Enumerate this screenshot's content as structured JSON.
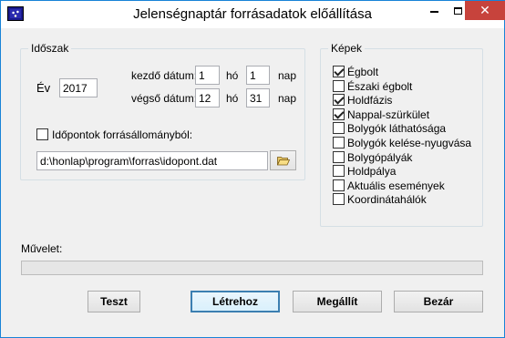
{
  "window": {
    "title": "Jelenségnaptár forrásadatok előállítása"
  },
  "idoszak": {
    "group_label": "Időszak",
    "ev_label": "Év",
    "ev_value": "2017",
    "kezdo_label": "kezdő dátum:",
    "kezdo_ho": "1",
    "kezdo_nap": "1",
    "vegso_label": "végső dátum:",
    "vegso_ho": "12",
    "vegso_nap": "31",
    "ho_label": "hó",
    "nap_label": "nap",
    "idopontok_label": "Időpontok forrásállományból:",
    "idopontok_checked": false,
    "path_value": "d:\\honlap\\program\\forras\\idopont.dat"
  },
  "kepek": {
    "group_label": "Képek",
    "items": [
      {
        "label": "Égbolt",
        "checked": true
      },
      {
        "label": "Északi égbolt",
        "checked": false
      },
      {
        "label": "Holdfázis",
        "checked": true
      },
      {
        "label": "Nappal-szürkület",
        "checked": true
      },
      {
        "label": "Bolygók láthatósága",
        "checked": false
      },
      {
        "label": "Bolygók kelése-nyugvása",
        "checked": false
      },
      {
        "label": "Bolygópályák",
        "checked": false
      },
      {
        "label": "Holdpálya",
        "checked": false
      },
      {
        "label": "Aktuális események",
        "checked": false
      },
      {
        "label": "Koordinátahálók",
        "checked": false
      }
    ]
  },
  "muvelet": {
    "label": "Művelet:",
    "progress": 0
  },
  "buttons": {
    "teszt": "Teszt",
    "letrehoz": "Létrehoz",
    "megallit": "Megállít",
    "bezar": "Bezár"
  },
  "colors": {
    "accent": "#1883d7",
    "close": "#c7433c",
    "progress": "#06b025"
  }
}
